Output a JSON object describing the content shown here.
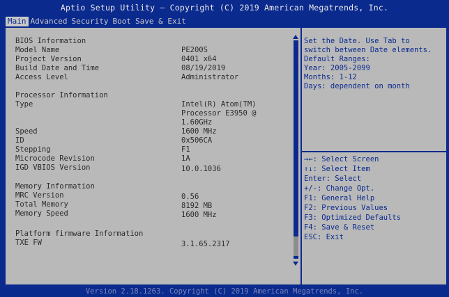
{
  "title": "Aptio Setup Utility – Copyright (C) 2019 American Megatrends, Inc.",
  "tabs": [
    "Main",
    "Advanced",
    "Security",
    "Boot",
    "Save & Exit"
  ],
  "left": {
    "bios_heading": "BIOS Information",
    "model_name_label": "Model Name",
    "model_name_value": "PE200S",
    "project_version_label": "Project Version",
    "project_version_value": "0401  x64",
    "build_date_label": "Build Date and Time",
    "build_date_value": "08/19/2019",
    "access_level_label": "Access Level",
    "access_level_value": "Administrator",
    "processor_heading": "Processor Information",
    "type_label": "Type",
    "type_value_line1": "Intel(R) Atom(TM)",
    "type_value_line2": "Processor E3950 @",
    "type_value_line3": "1.60GHz",
    "speed_label": "Speed",
    "speed_value": "1600 MHz",
    "id_label": "ID",
    "id_value": "0x506CA",
    "stepping_label": "Stepping",
    "stepping_value": "F1",
    "microcode_label": "Microcode Revision",
    "microcode_value": "1A",
    "igd_label": "IGD VBIOS Version",
    "igd_value": "10.0.1036",
    "memory_heading": "Memory Information",
    "mrc_label": "MRC Version",
    "mrc_value": "0.56",
    "total_memory_label": "Total Memory",
    "total_memory_value": "8192 MB",
    "memory_speed_label": "Memory Speed",
    "memory_speed_value": "1600 MHz",
    "platform_heading": "Platform firmware Information",
    "txe_label": "TXE FW",
    "txe_value": "3.1.65.2317"
  },
  "help": {
    "line1": "Set the Date. Use Tab to",
    "line2": "switch between Date elements.",
    "line3": "Default Ranges:",
    "line4": "Year: 2005-2099",
    "line5": "Months: 1-12",
    "line6": "Days: dependent on month"
  },
  "keys": {
    "k1": "→←: Select Screen",
    "k2": "↑↓: Select Item",
    "k3": "Enter: Select",
    "k4": "+/-: Change Opt.",
    "k5": "F1: General Help",
    "k6": "F2: Previous Values",
    "k7": "F3: Optimized Defaults",
    "k8": "F4: Save & Reset",
    "k9": "ESC: Exit"
  },
  "footer": "Version 2.18.1263. Copyright (C) 2019 American Megatrends, Inc.",
  "colors": {
    "background": "#0b2a8e",
    "panel": "#b9b9b9",
    "text": "#2b2b2b",
    "help_text": "#0b2a8e"
  }
}
